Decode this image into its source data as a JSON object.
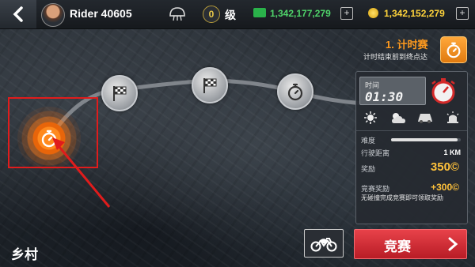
{
  "header": {
    "player_name": "Rider 40605",
    "level": "0",
    "level_label": "级",
    "cash": "1,342,177,279",
    "coins": "1,342,152,279"
  },
  "event": {
    "title": "1. 计时赛",
    "subtitle": "计时结束前到终点达"
  },
  "panel": {
    "time_label": "时间",
    "time_value": "01:30",
    "conditions": [
      "sun-icon",
      "partly-cloudy-icon",
      "car-icon",
      "police-light-icon"
    ],
    "difficulty_label": "难度",
    "difficulty_level": 0.95,
    "distance_label": "行驶距离",
    "distance_value": "1 KM",
    "reward_label": "奖励",
    "reward_value": "350©",
    "bonus_label": "竞赛奖励",
    "bonus_value": "+300©",
    "bonus_desc": "无碰撞完成竞赛即可领取奖励"
  },
  "footer": {
    "region": "乡村",
    "race_button": "竞赛"
  },
  "colors": {
    "accent_orange": "#ff9a1e",
    "race_red": "#d4303a",
    "cash_green": "#4fd46a",
    "coin_gold": "#ffd43b",
    "highlight_red": "#e01c1c"
  }
}
